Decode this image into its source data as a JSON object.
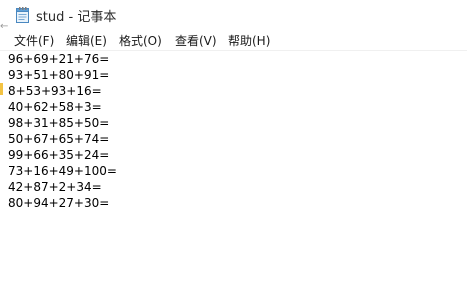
{
  "window": {
    "title": "stud - 记事本"
  },
  "menu": {
    "items": [
      {
        "label": "文件(F)"
      },
      {
        "label": "编辑(E)"
      },
      {
        "label": "格式(O)"
      },
      {
        "label": "查看(V)"
      },
      {
        "label": "帮助(H)"
      }
    ]
  },
  "editor": {
    "lines": [
      "96+69+21+76=",
      "93+51+80+91=",
      "8+53+93+16=",
      "40+62+58+3=",
      "98+31+85+50=",
      "50+67+65+74=",
      "99+66+35+24=",
      "73+16+49+100=",
      "42+87+2+34=",
      "80+94+27+30="
    ]
  },
  "edge": {
    "glyph": "←"
  },
  "colors": {
    "accent_marker": "#f3c343",
    "text": "#000000",
    "background": "#ffffff"
  },
  "icons": {
    "app": "notepad-icon"
  }
}
